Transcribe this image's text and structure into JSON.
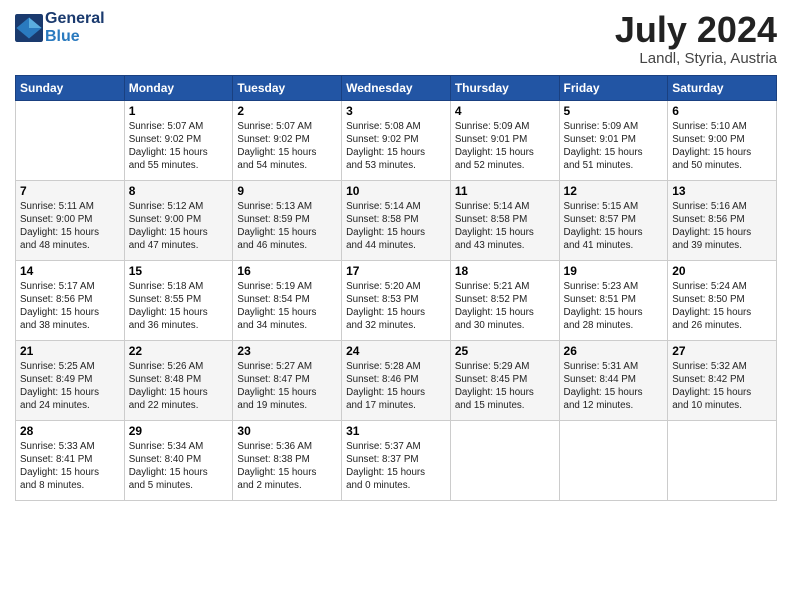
{
  "header": {
    "logo_line1": "General",
    "logo_line2": "Blue",
    "month": "July 2024",
    "location": "Landl, Styria, Austria"
  },
  "weekdays": [
    "Sunday",
    "Monday",
    "Tuesday",
    "Wednesday",
    "Thursday",
    "Friday",
    "Saturday"
  ],
  "weeks": [
    [
      {
        "day": "",
        "info": ""
      },
      {
        "day": "1",
        "info": "Sunrise: 5:07 AM\nSunset: 9:02 PM\nDaylight: 15 hours\nand 55 minutes."
      },
      {
        "day": "2",
        "info": "Sunrise: 5:07 AM\nSunset: 9:02 PM\nDaylight: 15 hours\nand 54 minutes."
      },
      {
        "day": "3",
        "info": "Sunrise: 5:08 AM\nSunset: 9:02 PM\nDaylight: 15 hours\nand 53 minutes."
      },
      {
        "day": "4",
        "info": "Sunrise: 5:09 AM\nSunset: 9:01 PM\nDaylight: 15 hours\nand 52 minutes."
      },
      {
        "day": "5",
        "info": "Sunrise: 5:09 AM\nSunset: 9:01 PM\nDaylight: 15 hours\nand 51 minutes."
      },
      {
        "day": "6",
        "info": "Sunrise: 5:10 AM\nSunset: 9:00 PM\nDaylight: 15 hours\nand 50 minutes."
      }
    ],
    [
      {
        "day": "7",
        "info": "Sunrise: 5:11 AM\nSunset: 9:00 PM\nDaylight: 15 hours\nand 48 minutes."
      },
      {
        "day": "8",
        "info": "Sunrise: 5:12 AM\nSunset: 9:00 PM\nDaylight: 15 hours\nand 47 minutes."
      },
      {
        "day": "9",
        "info": "Sunrise: 5:13 AM\nSunset: 8:59 PM\nDaylight: 15 hours\nand 46 minutes."
      },
      {
        "day": "10",
        "info": "Sunrise: 5:14 AM\nSunset: 8:58 PM\nDaylight: 15 hours\nand 44 minutes."
      },
      {
        "day": "11",
        "info": "Sunrise: 5:14 AM\nSunset: 8:58 PM\nDaylight: 15 hours\nand 43 minutes."
      },
      {
        "day": "12",
        "info": "Sunrise: 5:15 AM\nSunset: 8:57 PM\nDaylight: 15 hours\nand 41 minutes."
      },
      {
        "day": "13",
        "info": "Sunrise: 5:16 AM\nSunset: 8:56 PM\nDaylight: 15 hours\nand 39 minutes."
      }
    ],
    [
      {
        "day": "14",
        "info": "Sunrise: 5:17 AM\nSunset: 8:56 PM\nDaylight: 15 hours\nand 38 minutes."
      },
      {
        "day": "15",
        "info": "Sunrise: 5:18 AM\nSunset: 8:55 PM\nDaylight: 15 hours\nand 36 minutes."
      },
      {
        "day": "16",
        "info": "Sunrise: 5:19 AM\nSunset: 8:54 PM\nDaylight: 15 hours\nand 34 minutes."
      },
      {
        "day": "17",
        "info": "Sunrise: 5:20 AM\nSunset: 8:53 PM\nDaylight: 15 hours\nand 32 minutes."
      },
      {
        "day": "18",
        "info": "Sunrise: 5:21 AM\nSunset: 8:52 PM\nDaylight: 15 hours\nand 30 minutes."
      },
      {
        "day": "19",
        "info": "Sunrise: 5:23 AM\nSunset: 8:51 PM\nDaylight: 15 hours\nand 28 minutes."
      },
      {
        "day": "20",
        "info": "Sunrise: 5:24 AM\nSunset: 8:50 PM\nDaylight: 15 hours\nand 26 minutes."
      }
    ],
    [
      {
        "day": "21",
        "info": "Sunrise: 5:25 AM\nSunset: 8:49 PM\nDaylight: 15 hours\nand 24 minutes."
      },
      {
        "day": "22",
        "info": "Sunrise: 5:26 AM\nSunset: 8:48 PM\nDaylight: 15 hours\nand 22 minutes."
      },
      {
        "day": "23",
        "info": "Sunrise: 5:27 AM\nSunset: 8:47 PM\nDaylight: 15 hours\nand 19 minutes."
      },
      {
        "day": "24",
        "info": "Sunrise: 5:28 AM\nSunset: 8:46 PM\nDaylight: 15 hours\nand 17 minutes."
      },
      {
        "day": "25",
        "info": "Sunrise: 5:29 AM\nSunset: 8:45 PM\nDaylight: 15 hours\nand 15 minutes."
      },
      {
        "day": "26",
        "info": "Sunrise: 5:31 AM\nSunset: 8:44 PM\nDaylight: 15 hours\nand 12 minutes."
      },
      {
        "day": "27",
        "info": "Sunrise: 5:32 AM\nSunset: 8:42 PM\nDaylight: 15 hours\nand 10 minutes."
      }
    ],
    [
      {
        "day": "28",
        "info": "Sunrise: 5:33 AM\nSunset: 8:41 PM\nDaylight: 15 hours\nand 8 minutes."
      },
      {
        "day": "29",
        "info": "Sunrise: 5:34 AM\nSunset: 8:40 PM\nDaylight: 15 hours\nand 5 minutes."
      },
      {
        "day": "30",
        "info": "Sunrise: 5:36 AM\nSunset: 8:38 PM\nDaylight: 15 hours\nand 2 minutes."
      },
      {
        "day": "31",
        "info": "Sunrise: 5:37 AM\nSunset: 8:37 PM\nDaylight: 15 hours\nand 0 minutes."
      },
      {
        "day": "",
        "info": ""
      },
      {
        "day": "",
        "info": ""
      },
      {
        "day": "",
        "info": ""
      }
    ]
  ]
}
